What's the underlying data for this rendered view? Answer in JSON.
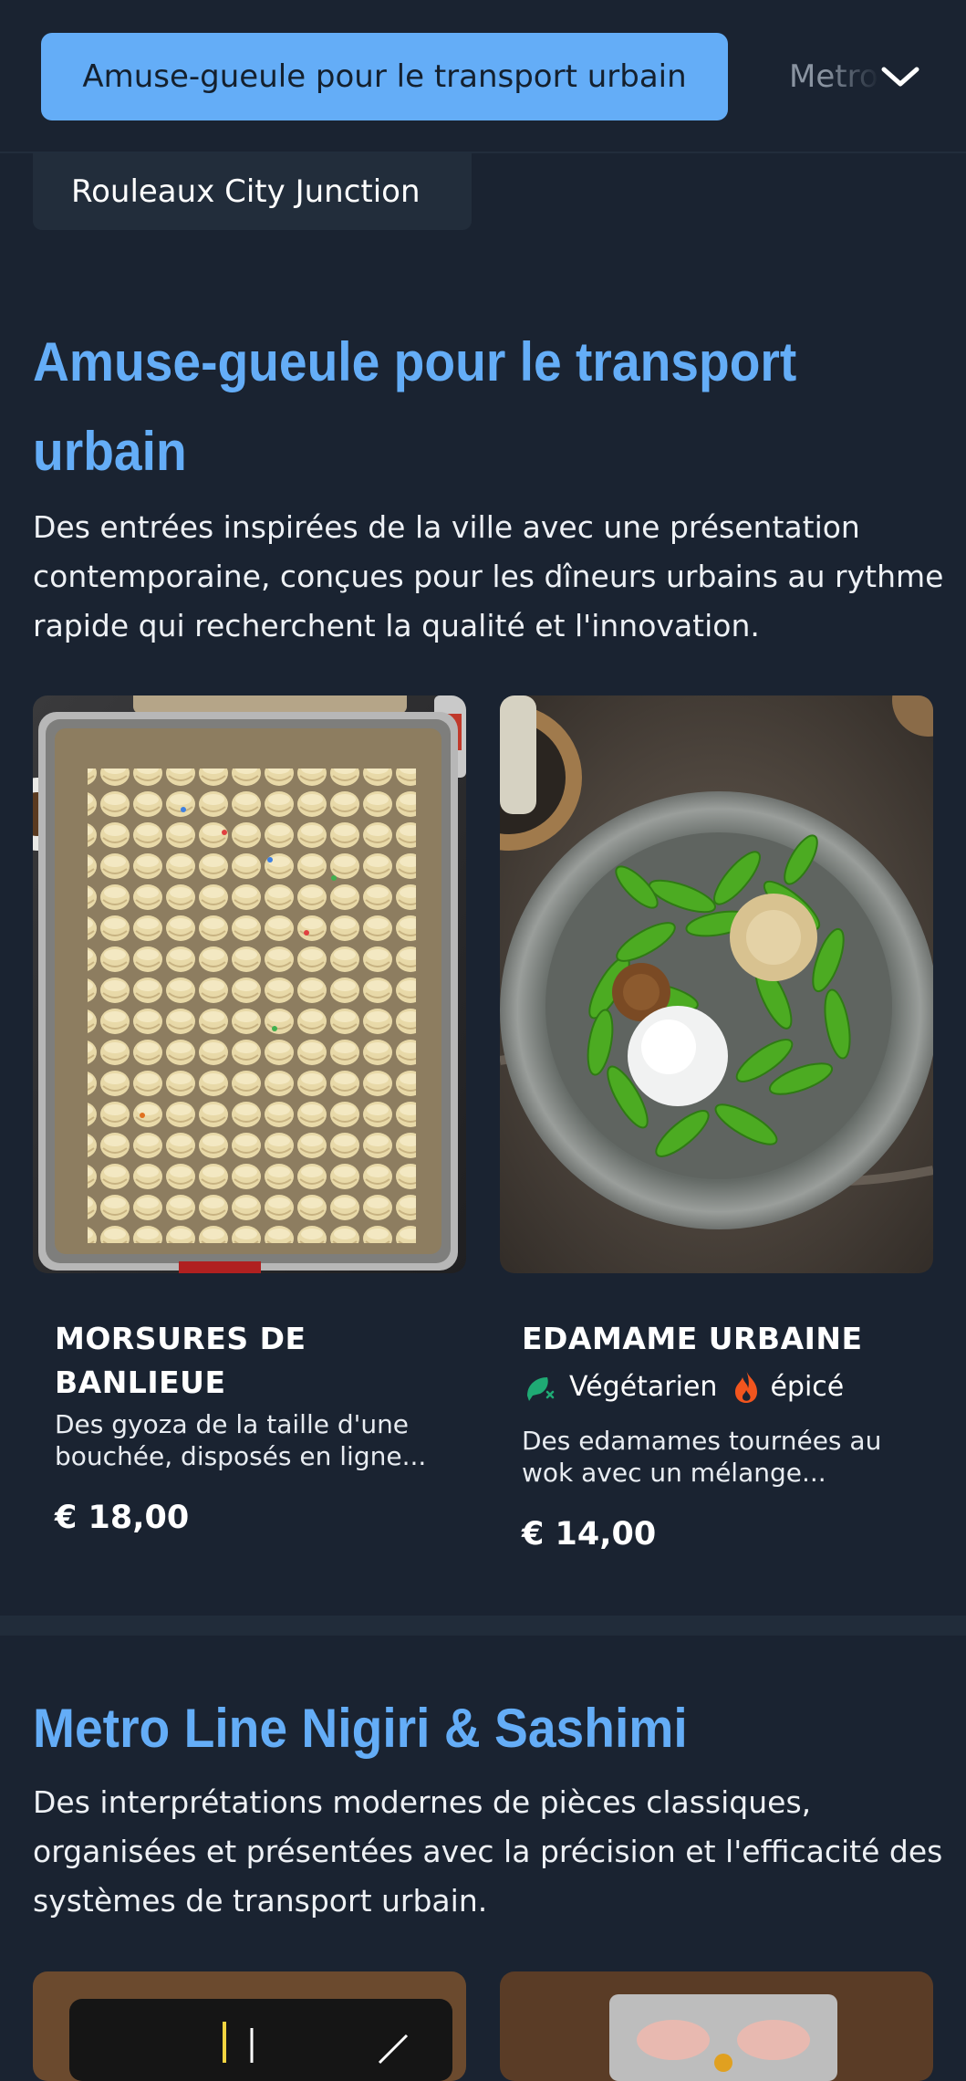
{
  "nav": {
    "active_tab": "Amuse-gueule pour le transport urbain",
    "next_tab": "Metro Line Nigiri & Sashimi",
    "expand_icon": "chevron-down-icon"
  },
  "subcategory_chip": "Rouleaux City Junction",
  "sections": [
    {
      "title": "Amuse-gueule pour le transport urbain",
      "description": "Des entrées inspirées de la ville avec une présentation contemporaine, conçues pour les dîneurs urbains au rythme rapide qui recherchent la qualité et l'innovation.",
      "items": [
        {
          "name": "MORSURES DE BANLIEUE",
          "description": "Des gyoza de la taille d'une bouchée, disposés en ligne...",
          "price": "€ 18,00",
          "tags": []
        },
        {
          "name": "EDAMAME URBAINE",
          "tags": [
            {
              "icon": "vegetarian-icon",
              "label": "Végétarien"
            },
            {
              "icon": "spicy-icon",
              "label": "épicé"
            }
          ],
          "description": "Des edamames tournées au wok avec un mélange...",
          "price": "€ 14,00"
        }
      ]
    },
    {
      "title": "Metro Line Nigiri & Sashimi",
      "description": "Des interprétations modernes de pièces classiques, organisées et présentées avec la précision et l'efficacité des systèmes de transport urbain."
    }
  ],
  "colors": {
    "background": "#1a2331",
    "accent": "#64adf7",
    "chip": "#222d3b",
    "vegetarian": "#1faa74",
    "spicy": "#f2551e"
  }
}
